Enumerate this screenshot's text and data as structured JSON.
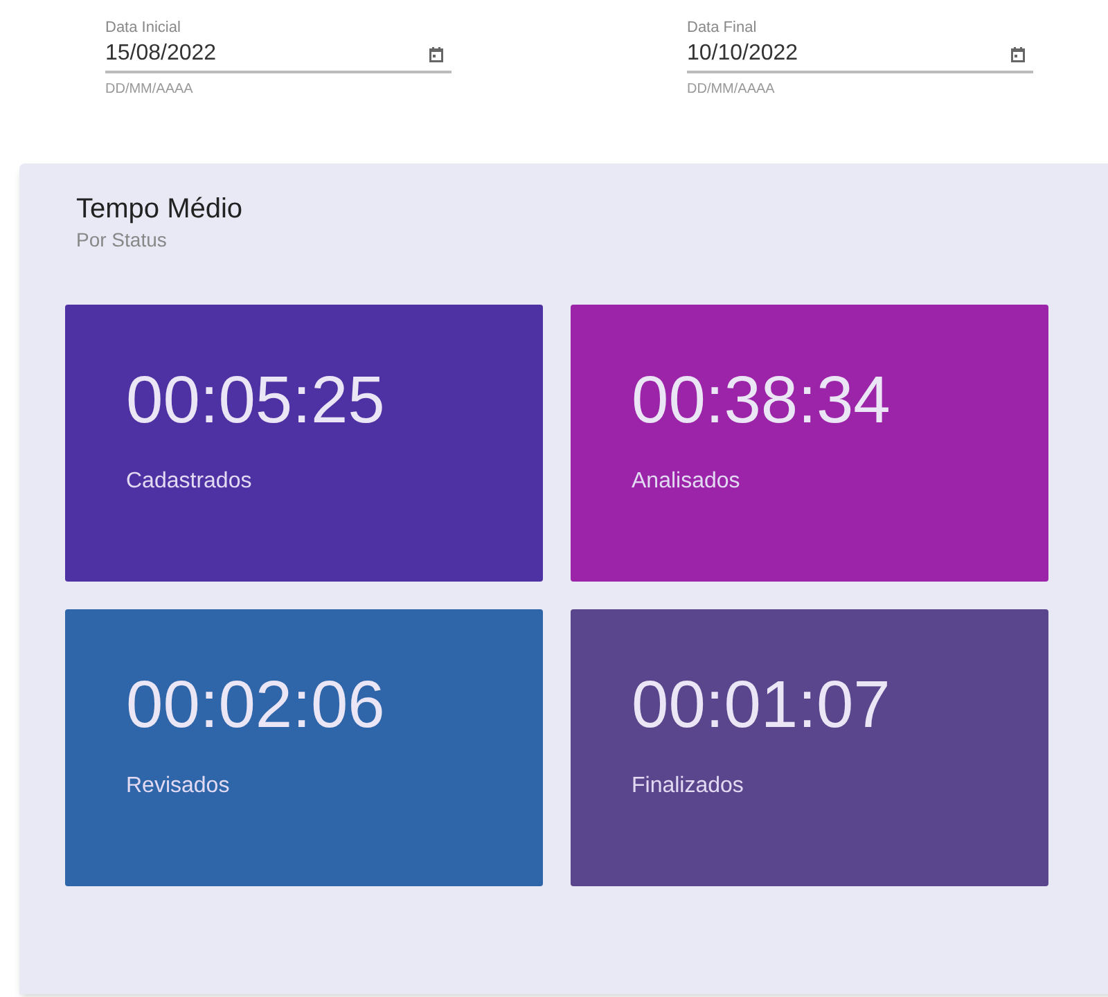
{
  "date_fields": [
    {
      "label": "Data Inicial",
      "value": "15/08/2022",
      "hint": "DD/MM/AAAA"
    },
    {
      "label": "Data Final",
      "value": "10/10/2022",
      "hint": "DD/MM/AAAA"
    }
  ],
  "card": {
    "title": "Tempo Médio",
    "subtitle": "Por Status",
    "tiles": [
      {
        "time": "00:05:25",
        "label": "Cadastrados",
        "color": "#4e31a3"
      },
      {
        "time": "00:38:34",
        "label": "Analisados",
        "color": "#9c24a8"
      },
      {
        "time": "00:02:06",
        "label": "Revisados",
        "color": "#2f66a9"
      },
      {
        "time": "00:01:07",
        "label": "Finalizados",
        "color": "#5a468c"
      }
    ]
  }
}
